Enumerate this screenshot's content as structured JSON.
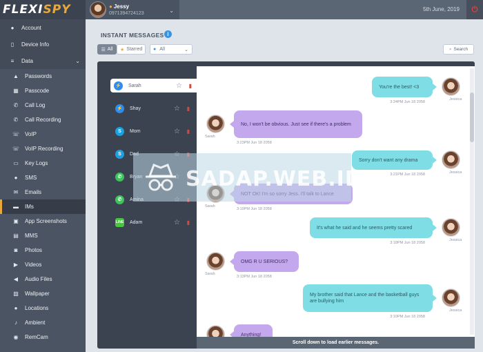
{
  "app": {
    "logo_part1": "FLEXI",
    "logo_part2": "SPY",
    "user_name": "Jessy",
    "user_phone": "0971394724123",
    "date": "5th June, 2019"
  },
  "sidebar": {
    "account": "Account",
    "device_info": "Device Info",
    "data": "Data",
    "items": [
      {
        "label": "Passwords",
        "icon": "lock-icon"
      },
      {
        "label": "Passcode",
        "icon": "grid-icon"
      },
      {
        "label": "Call Log",
        "icon": "phone-icon"
      },
      {
        "label": "Call Recording",
        "icon": "phone-recording-icon"
      },
      {
        "label": "VoIP",
        "icon": "voip-icon"
      },
      {
        "label": "VoIP Recording",
        "icon": "voip-recording-icon"
      },
      {
        "label": "Key Logs",
        "icon": "keyboard-icon"
      },
      {
        "label": "SMS",
        "icon": "chat-icon"
      },
      {
        "label": "Emails",
        "icon": "envelope-icon"
      },
      {
        "label": "IMs",
        "icon": "folder-icon"
      },
      {
        "label": "App Screenshots",
        "icon": "image-icon"
      },
      {
        "label": "MMS",
        "icon": "mms-icon"
      },
      {
        "label": "Photos",
        "icon": "camera-icon"
      },
      {
        "label": "Videos",
        "icon": "video-icon"
      },
      {
        "label": "Audio Files",
        "icon": "speaker-icon"
      },
      {
        "label": "Wallpaper",
        "icon": "wallpaper-icon"
      },
      {
        "label": "Locations",
        "icon": "location-pin-icon"
      },
      {
        "label": "Ambient",
        "icon": "microphone-icon"
      },
      {
        "label": "RemCam",
        "icon": "webcam-icon"
      }
    ]
  },
  "header": {
    "title": "INSTANT MESSAGES",
    "filter_all": "All",
    "filter_starred": "Starred",
    "select_value": "All",
    "search_label": "Search"
  },
  "contacts": [
    {
      "name": "Sarah",
      "app": "messenger"
    },
    {
      "name": "Shay",
      "app": "messenger"
    },
    {
      "name": "Mom",
      "app": "skype"
    },
    {
      "name": "Dad",
      "app": "skype"
    },
    {
      "name": "Bryan",
      "app": "whatsapp"
    },
    {
      "name": "Amina",
      "app": "whatsapp"
    },
    {
      "name": "Adam",
      "app": "line"
    }
  ],
  "messages": [
    {
      "dir": "out",
      "text": "You're the best! <3",
      "time": "3:24PM Jun 18 2058",
      "sender": "Jessica"
    },
    {
      "dir": "in",
      "text": "No, I won't be obvious. Just see if there's a problem",
      "time": "3:23PM Jun 18 2058",
      "sender": "Sarah"
    },
    {
      "dir": "out",
      "text": "Sorry don't want any drama",
      "time": "3:21PM Jun 18 2058",
      "sender": "Jessica"
    },
    {
      "dir": "in",
      "text": "NOT OK! I'm so sorry Jess. I'll talk to Lance",
      "time": "3:19PM Jun 18 2058",
      "sender": "Sarah"
    },
    {
      "dir": "out",
      "text": "It's what he said and he seems pretty scared",
      "time": "3:18PM Jun 18 2058",
      "sender": "Jessica"
    },
    {
      "dir": "in",
      "text": "OMG R U SERIOUS?",
      "time": "3:13PM Jun 18 2058",
      "sender": "Sarah"
    },
    {
      "dir": "out",
      "text": "My brother said that Lance and the basketball guys are bullying him",
      "time": "3:10PM Jun 18 2058",
      "sender": "Jessica"
    },
    {
      "dir": "in",
      "text": "Anything!",
      "time": "",
      "sender": ""
    }
  ],
  "footer": {
    "load_more": "Scroll down to load earlier messages."
  },
  "watermark": "SADAP.WEB.ID",
  "colors": {
    "accent": "#e9a93a",
    "outgoing_bubble": "#7fdde6",
    "incoming_bubble": "#c4a8ee",
    "sidebar": "#4b5463"
  }
}
